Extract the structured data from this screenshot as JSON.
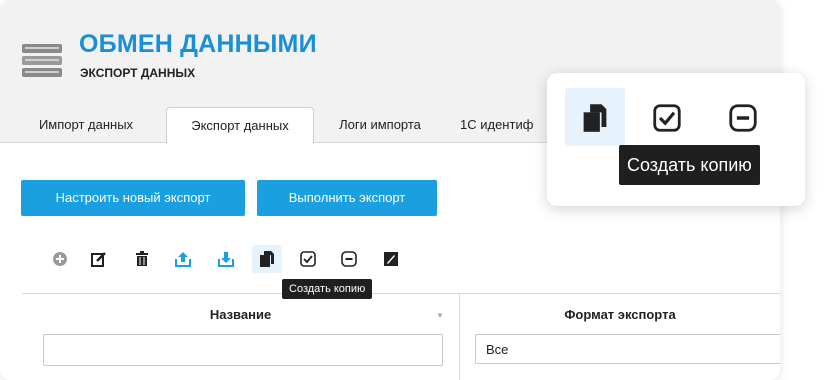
{
  "header": {
    "title": "ОБМЕН ДАННЫМИ",
    "subtitle": "ЭКСПОРТ ДАННЫХ",
    "icon": "server-stack-icon"
  },
  "tabs": [
    {
      "label": "Импорт данных",
      "active": false
    },
    {
      "label": "Экспорт данных",
      "active": true
    },
    {
      "label": "Логи импорта",
      "active": false
    },
    {
      "label": "1С идентиф",
      "active": false
    }
  ],
  "actions": {
    "configure_label": "Настроить новый экспорт",
    "run_label": "Выполнить экспорт"
  },
  "toolbar": {
    "icons": [
      "add-icon",
      "edit-icon",
      "delete-icon",
      "upload-icon",
      "download-icon",
      "copy-icon",
      "check-icon",
      "minus-icon",
      "image-icon"
    ],
    "selected": "copy-icon",
    "tooltip": "Создать копию"
  },
  "table": {
    "columns": [
      "Название",
      "Формат экспорта"
    ],
    "name_filter_value": "",
    "format_filter_value": "Все"
  },
  "zoom": {
    "tooltip": "Создать копию"
  },
  "colors": {
    "accent": "#1a9fe0",
    "title": "#1a8fd6",
    "selected_bg": "#e6f3fc"
  }
}
